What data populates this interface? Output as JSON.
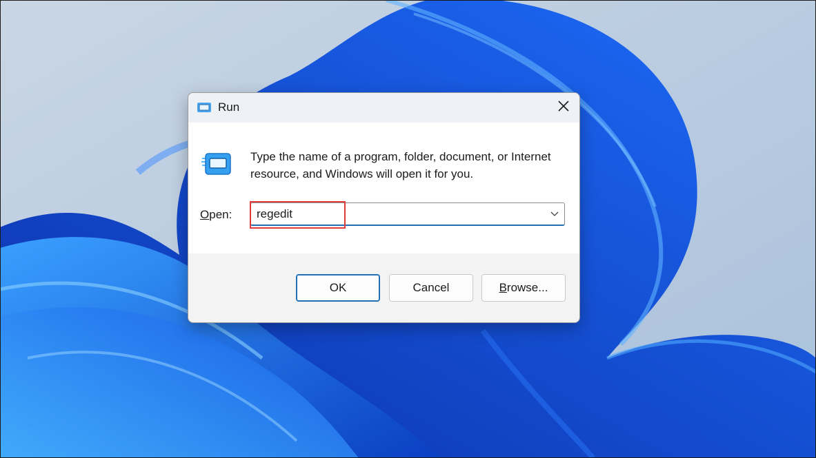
{
  "dialog": {
    "title": "Run",
    "close_icon": "close-icon",
    "app_icon": "run-icon",
    "description": "Type the name of a program, folder, document, or Internet resource, and Windows will open it for you.",
    "open_label_access_key": "O",
    "open_label_rest": "pen:",
    "open_value": "regedit",
    "dropdown_icon": "chevron-down-icon",
    "buttons": {
      "ok": "OK",
      "cancel": "Cancel",
      "browse_access_key": "B",
      "browse_rest": "rowse..."
    }
  },
  "colors": {
    "accent": "#1f6fb5",
    "highlight": "#e03a3a",
    "wallpaper_bg": "#b8c9dc",
    "wallpaper_blue": "#1456e0"
  }
}
